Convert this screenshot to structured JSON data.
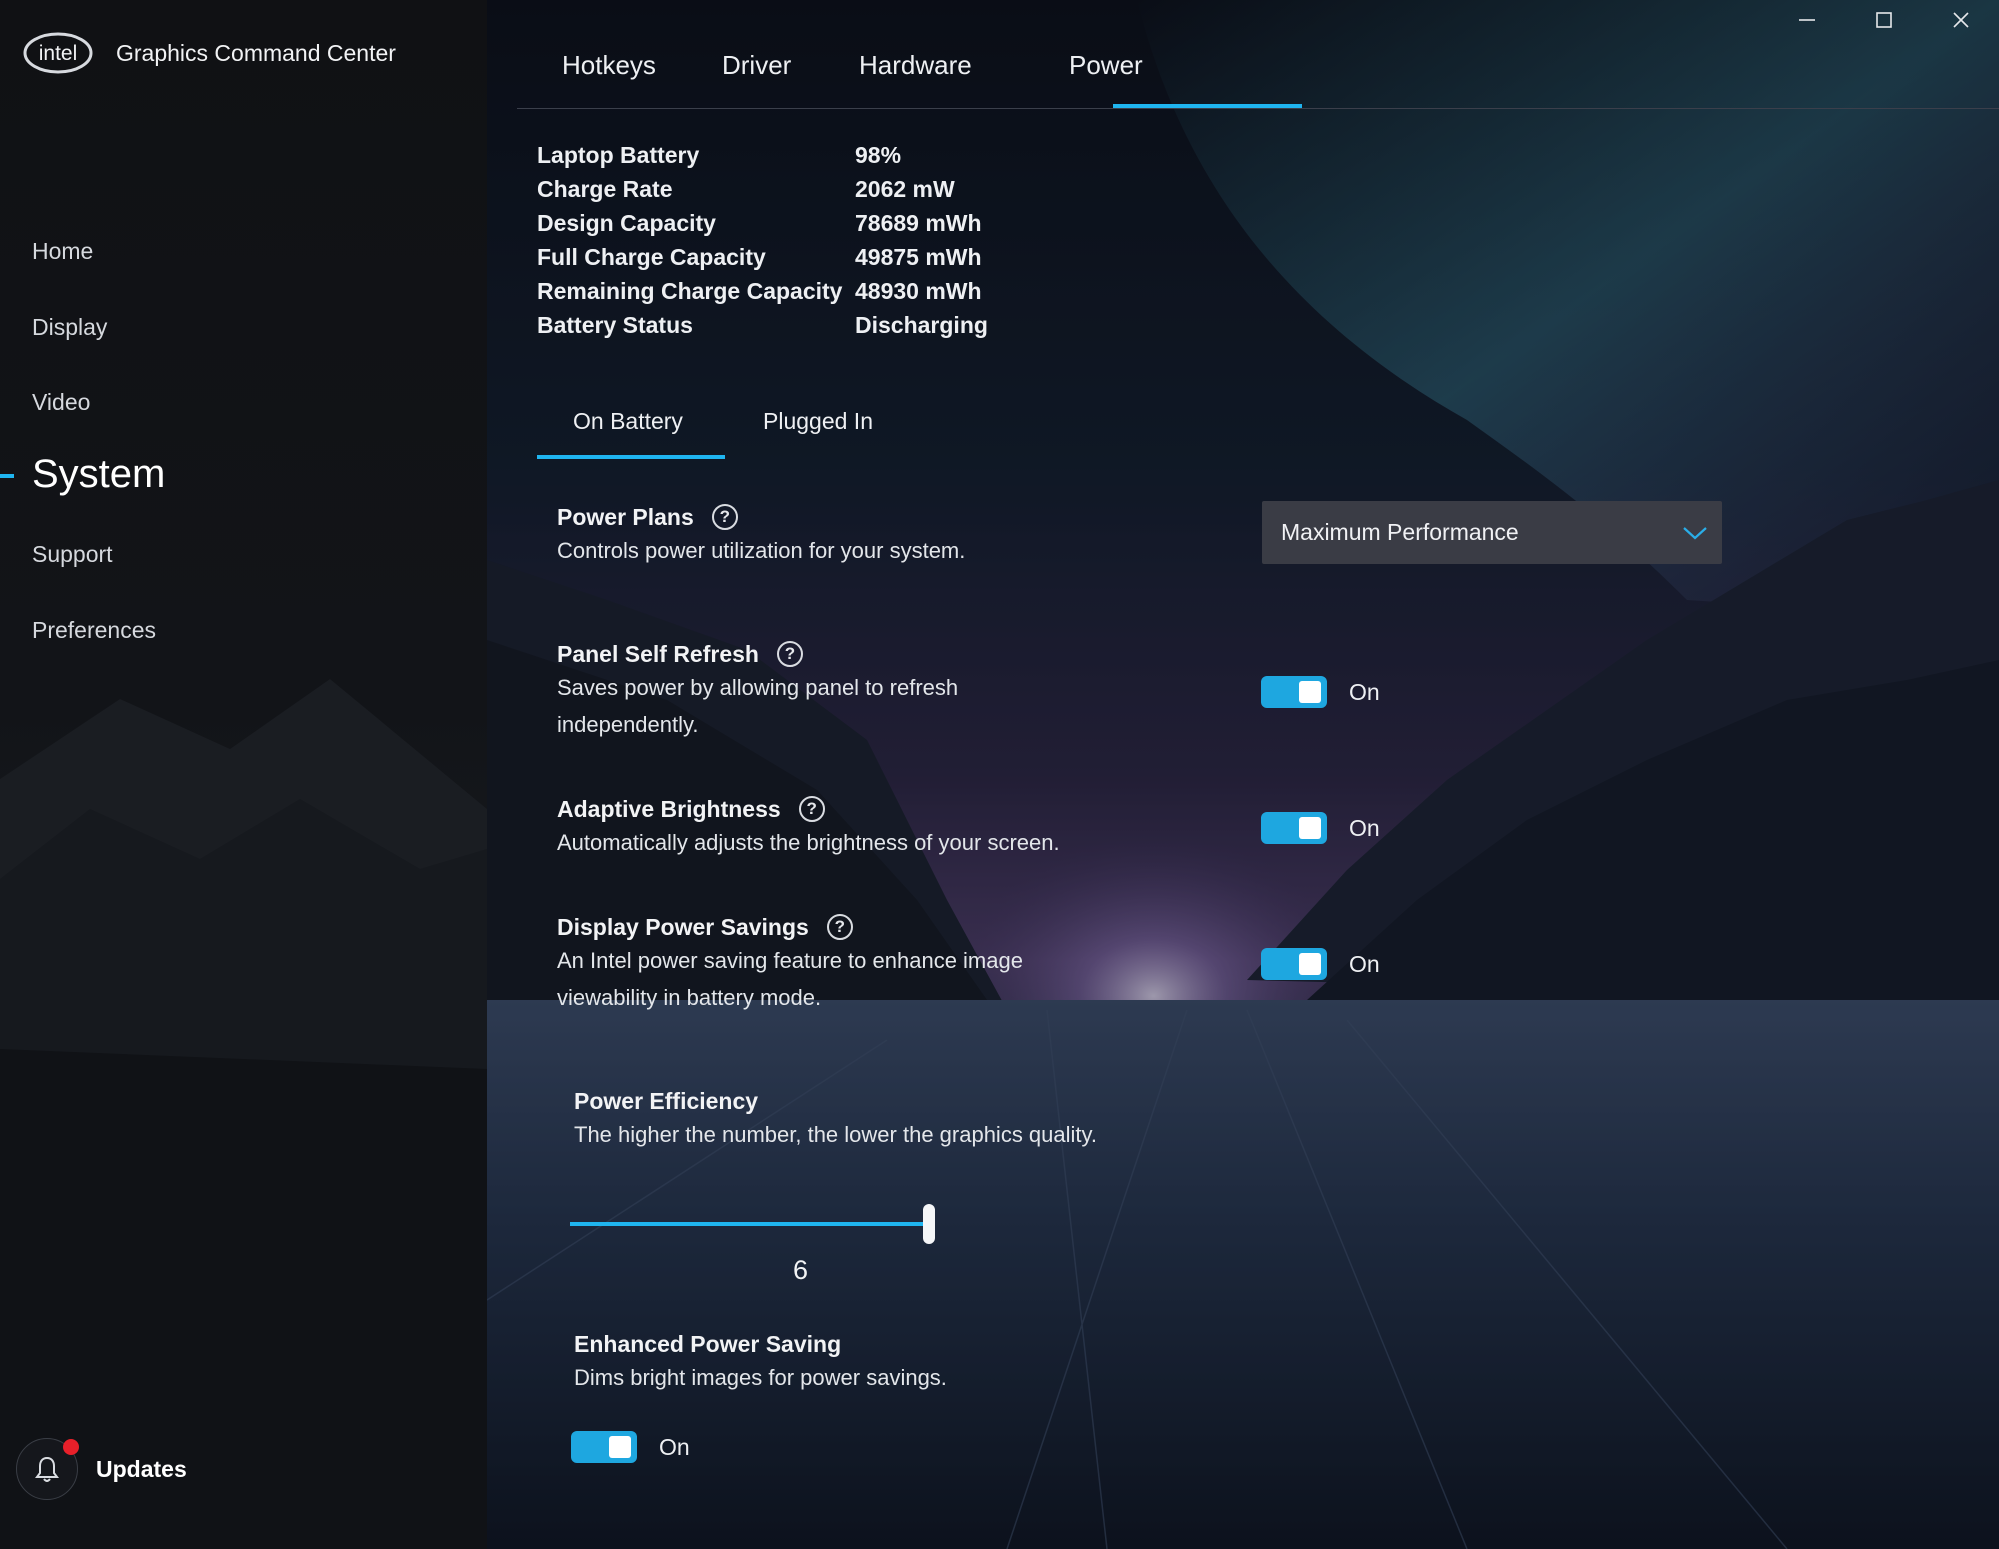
{
  "app": {
    "title": "Graphics Command Center",
    "logo_text": "intel"
  },
  "sidebar": {
    "items": [
      {
        "label": "Home"
      },
      {
        "label": "Display"
      },
      {
        "label": "Video"
      },
      {
        "label": "System",
        "active": true
      },
      {
        "label": "Support"
      },
      {
        "label": "Preferences"
      }
    ],
    "updates_label": "Updates",
    "updates_badge_color": "#e8202a"
  },
  "window_controls": {
    "icons": [
      "minimize-icon",
      "maximize-icon",
      "close-icon"
    ]
  },
  "tabs": [
    {
      "label": "Hotkeys"
    },
    {
      "label": "Driver"
    },
    {
      "label": "Hardware"
    },
    {
      "label": "Power",
      "active": true
    }
  ],
  "battery": {
    "rows": [
      {
        "label": "Laptop Battery",
        "value": "98%"
      },
      {
        "label": "Charge Rate",
        "value": "2062 mW"
      },
      {
        "label": "Design Capacity",
        "value": "78689 mWh"
      },
      {
        "label": "Full Charge Capacity",
        "value": "49875 mWh"
      },
      {
        "label": "Remaining Charge Capacity",
        "value": "48930 mWh"
      },
      {
        "label": "Battery Status",
        "value": "Discharging"
      }
    ]
  },
  "subtabs": [
    {
      "label": "On Battery",
      "active": true
    },
    {
      "label": "Plugged In"
    }
  ],
  "settings": {
    "power_plans": {
      "title": "Power Plans",
      "desc": "Controls power utilization for your system.",
      "selected": "Maximum Performance"
    },
    "panel_self_refresh": {
      "title": "Panel Self Refresh",
      "desc": "Saves power by allowing panel to refresh independently.",
      "state": "On"
    },
    "adaptive_brightness": {
      "title": "Adaptive Brightness",
      "desc": "Automatically adjusts the brightness of your screen.",
      "state": "On"
    },
    "display_power_savings": {
      "title": "Display Power Savings",
      "desc": "An Intel power saving feature to enhance image viewability in battery mode.",
      "state": "On"
    },
    "power_efficiency": {
      "title": "Power Efficiency",
      "desc": "The higher the number, the lower the graphics quality.",
      "value": "6",
      "fill_fraction": 0.78
    },
    "enhanced_power_saving": {
      "title": "Enhanced Power Saving",
      "desc": "Dims bright images for power savings.",
      "state": "On"
    }
  },
  "colors": {
    "accent": "#1fb5f0",
    "toggle": "#1ea7e0",
    "dropdown_bg": "#3a3c45"
  }
}
